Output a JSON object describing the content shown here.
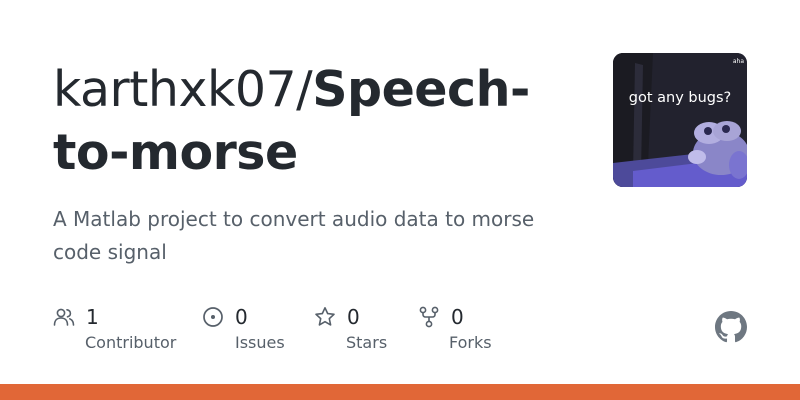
{
  "repo": {
    "owner": "karthxk07/",
    "name": "Speech-to-morse",
    "description": "A Matlab project to convert audio data to morse code signal"
  },
  "avatar": {
    "caption": "got any bugs?",
    "tag": "aha"
  },
  "stats": {
    "contributors": {
      "value": "1",
      "label": "Contributor",
      "icon": "people-icon"
    },
    "issues": {
      "value": "0",
      "label": "Issues",
      "icon": "issue-icon"
    },
    "stars": {
      "value": "0",
      "label": "Stars",
      "icon": "star-icon"
    },
    "forks": {
      "value": "0",
      "label": "Forks",
      "icon": "fork-icon"
    }
  },
  "colors": {
    "text": "#24292f",
    "muted": "#57606a",
    "language_bar": "#e16737",
    "github_mark": "#6e7781"
  }
}
